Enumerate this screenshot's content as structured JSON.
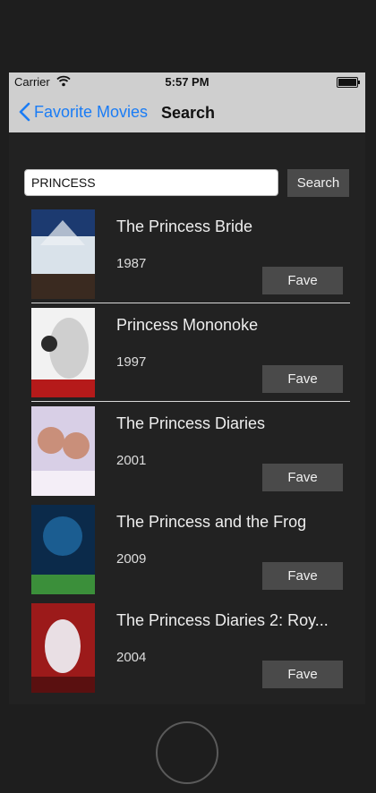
{
  "status_bar": {
    "carrier": "Carrier",
    "time": "5:57 PM"
  },
  "nav": {
    "back_label": "Favorite Movies",
    "title": "Search"
  },
  "search": {
    "value": "PRINCESS",
    "button_label": "Search"
  },
  "results": [
    {
      "title": "The Princess Bride",
      "year": "1987",
      "fave_label": "Fave",
      "poster_colors": [
        "#1c3a70",
        "#d9e2ea",
        "#3a2a20"
      ]
    },
    {
      "title": "Princess Mononoke",
      "year": "1997",
      "fave_label": "Fave",
      "poster_colors": [
        "#f2f2f2",
        "#cfcfcf",
        "#b51a1a"
      ]
    },
    {
      "title": "The Princess Diaries",
      "year": "2001",
      "fave_label": "Fave",
      "poster_colors": [
        "#d8cfe6",
        "#c98f7a",
        "#f4eef7"
      ]
    },
    {
      "title": "The Princess and the Frog",
      "year": "2009",
      "fave_label": "Fave",
      "poster_colors": [
        "#0b2a4a",
        "#1f6aa3",
        "#3b8f3a"
      ]
    },
    {
      "title": "The Princess Diaries 2: Roy...",
      "year": "2004",
      "fave_label": "Fave",
      "poster_colors": [
        "#9c1a1a",
        "#e9dfe4",
        "#5a1010"
      ]
    }
  ]
}
